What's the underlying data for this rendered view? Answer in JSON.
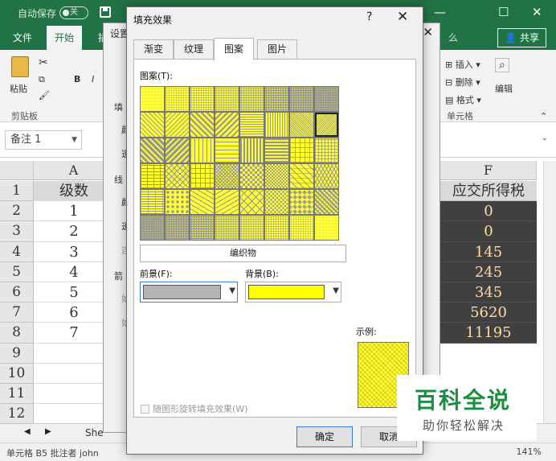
{
  "excel": {
    "autosave_label": "自动保存",
    "autosave_state": "关",
    "tabs": [
      "文件",
      "开始",
      "插"
    ],
    "share": "共享",
    "ribbon": {
      "paste": "粘贴",
      "clipboard": "剪贴板",
      "bold": "B",
      "italic": "I",
      "insert": "插入",
      "delete": "删除",
      "format": "格式",
      "cells": "单元格",
      "edit": "编辑",
      "find_partial": "么"
    },
    "name_box": "备注 1",
    "columns": [
      "A",
      "F"
    ],
    "rows": [
      "1",
      "2",
      "3",
      "4",
      "5",
      "6",
      "7",
      "8",
      "9",
      "10",
      "11",
      "12"
    ],
    "col_a": [
      "级数",
      "1",
      "2",
      "3",
      "4",
      "5",
      "6",
      "7"
    ],
    "col_f": [
      "应交所得税",
      "0",
      "0",
      "145",
      "245",
      "345",
      "5620",
      "11195"
    ],
    "sheet_tab": "She",
    "status": "单元格 B5 批注者 john",
    "zoom": "141%"
  },
  "back_dialog": {
    "title": "设置",
    "labels": [
      "填",
      "颜",
      "透",
      "线",
      "颜",
      "透",
      "连",
      "箭",
      "始",
      "始"
    ]
  },
  "dialog": {
    "title": "填充效果",
    "help": "?",
    "tabs": [
      "渐变",
      "纹理",
      "图案",
      "图片"
    ],
    "active_tab": "图案",
    "pattern_label": "图案(T):",
    "pattern_name": "编织物",
    "foreground_label": "前景(F):",
    "background_label": "背景(B):",
    "foreground_color": "#b4b4b4",
    "background_color": "#ffff00",
    "sample_label": "示例:",
    "rotate_label": "随图形旋转填充效果(W)",
    "ok": "确定",
    "cancel": "取消"
  },
  "watermark": {
    "main": "百科全说",
    "sub": "助你轻松解决"
  }
}
